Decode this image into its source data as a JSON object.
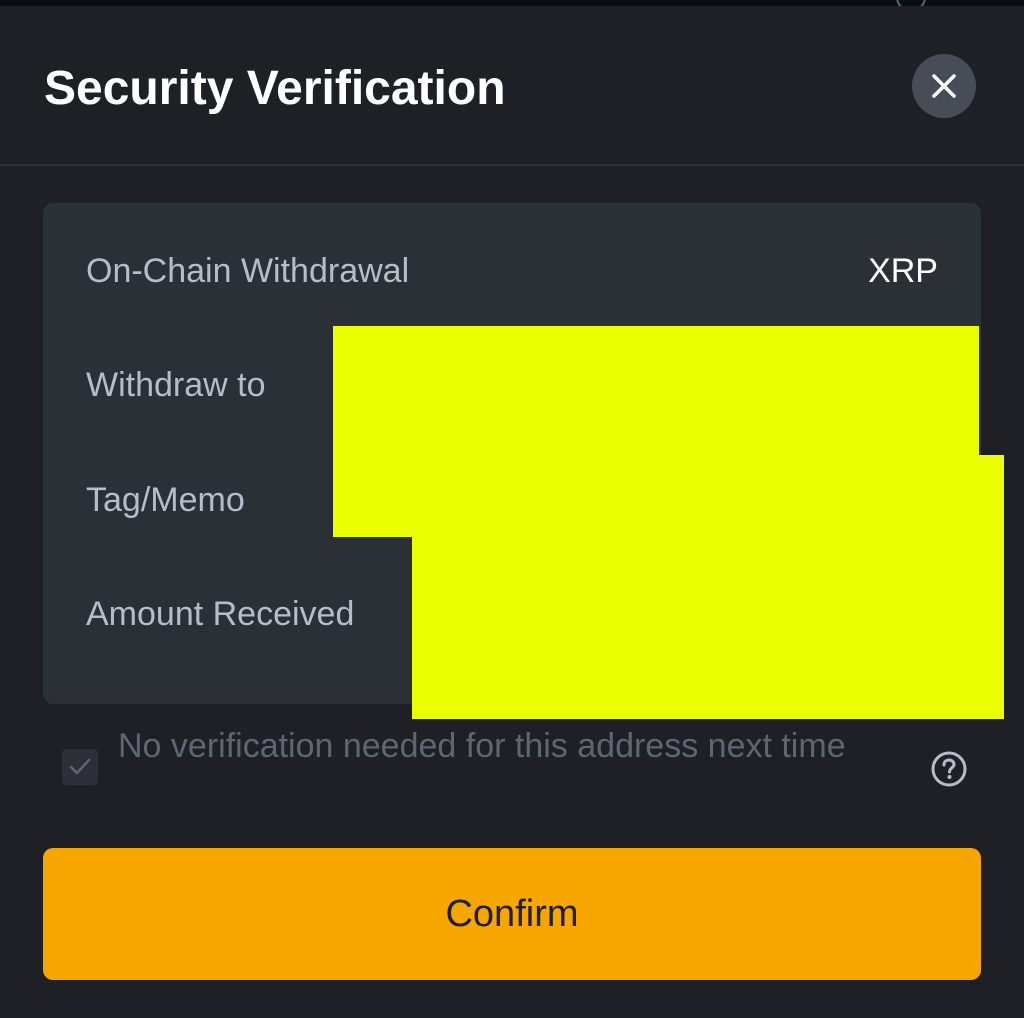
{
  "dialog": {
    "title": "Security Verification"
  },
  "details": {
    "rows": [
      {
        "label": "On-Chain Withdrawal",
        "value": "XRP"
      },
      {
        "label": "Withdraw to",
        "value": ""
      },
      {
        "label": "Tag/Memo",
        "value": ""
      },
      {
        "label": "Amount Received",
        "value": ""
      }
    ]
  },
  "options": {
    "skip_verification_label": "No verification needed for this address next time",
    "skip_verification_checked": true
  },
  "actions": {
    "confirm_label": "Confirm"
  },
  "colors": {
    "background": "#1e2026",
    "card": "#2b2f36",
    "accent": "#f7a600",
    "redaction": "#eaff00"
  },
  "icons": {
    "close": "close-icon",
    "check": "check-icon",
    "help": "help-icon"
  }
}
